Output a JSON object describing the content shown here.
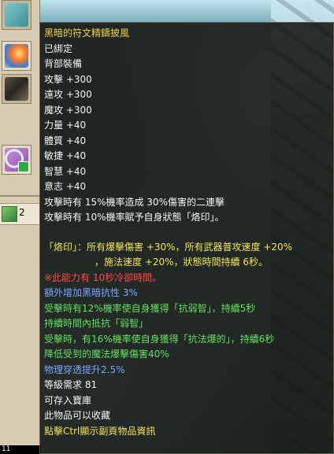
{
  "inventory": {
    "stack_count": "2",
    "status_text": "11"
  },
  "tooltip": {
    "item_name": "黑暗的符文精鑄披風",
    "bind_status": "已綁定",
    "slot_type": "背部裝備",
    "stats": [
      "攻擊 +300",
      "遠攻 +300",
      "魔攻 +300",
      "力量 +40",
      "體質 +40",
      "敏捷 +40",
      "智慧 +40",
      "意志 +40"
    ],
    "effects": [
      "攻擊時有 15%機率造成 30%傷害的二連擊",
      "攻擊時有 10%機率賦予自身狀態「烙印」。"
    ],
    "brand_desc_1": "「烙印」：所有爆擊傷害 +30%，所有武器普攻速度 +20%",
    "brand_desc_2": "，施法速度 +20%，狀態時間持續 6秒。",
    "cooldown_note": "※此能力有 10秒冷卻時間。",
    "dark_resist": "額外增加黑暗抗性 3%",
    "weaken_1": "受擊時有12%機率使自身獲得「抗弱智」，持續5秒",
    "weaken_2": "持續時間內抵抗「弱智」",
    "anti_burst_1": "受擊時，有16%機率使自身獲得「抗法爆的」，持續6秒",
    "anti_burst_2": "降低受到的魔法爆擊傷害40%",
    "penetration": "物理穿透提升2.5%",
    "level_req": "等級需求 81",
    "storable": "可存入寶庫",
    "collectable": "此物品可以收藏",
    "ctrl_hint": "點擊Ctrl顯示副頁物品資訊"
  },
  "colors": {
    "title": "#f0d24a",
    "yellow": "#f3e35a",
    "red": "#ff4848",
    "blue": "#7aa6ff",
    "green": "#63e060"
  },
  "icons": [
    "wing-cape-icon",
    "claw-icon",
    "ring-icon",
    "leaf-icon"
  ]
}
